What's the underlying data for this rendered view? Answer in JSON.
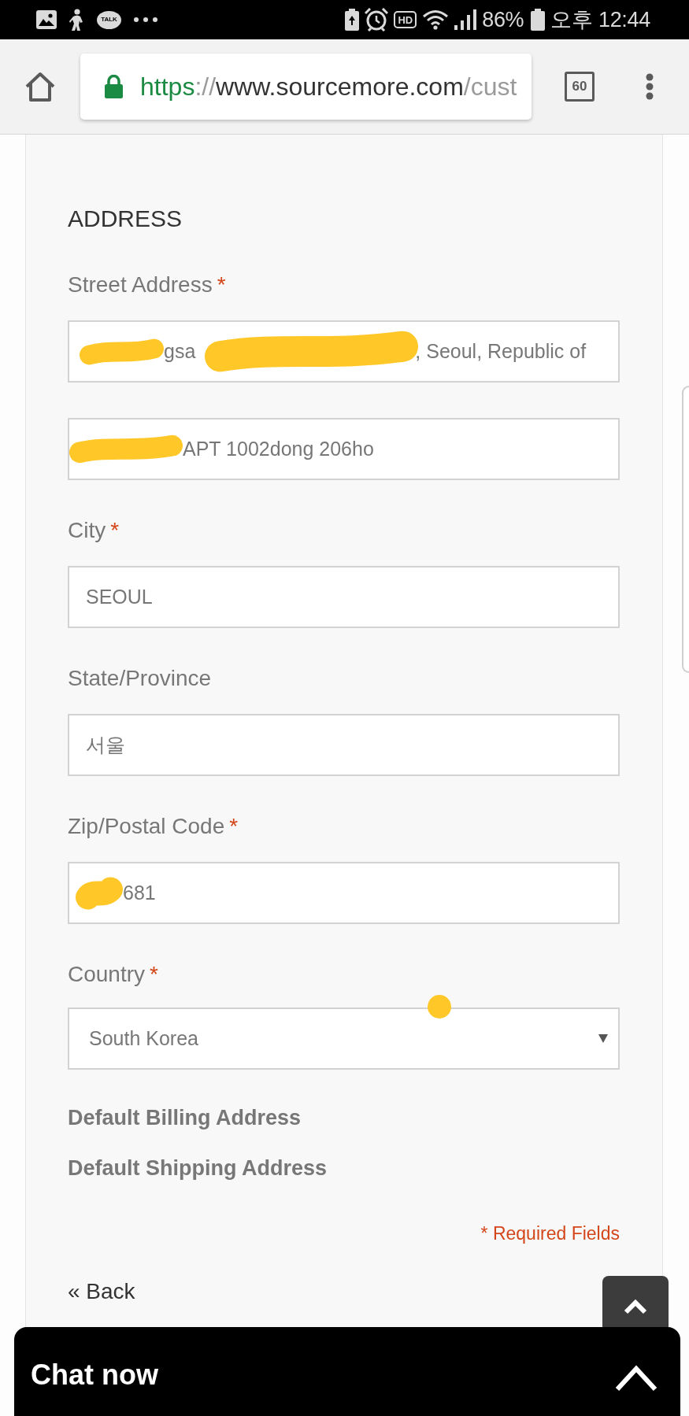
{
  "status_bar": {
    "notification_badge": "TALK",
    "network_badge": "HD",
    "battery": "86%",
    "time": "오후 12:44"
  },
  "browser": {
    "url": {
      "scheme": "https",
      "separator": "://",
      "host": "www.sourcemore.com",
      "path": "/cust"
    },
    "tab_count": "60"
  },
  "form": {
    "heading": "ADDRESS",
    "fields": [
      {
        "kind": "text",
        "label": "Street Address",
        "required_mark": "*",
        "inputs": [
          [
            {
              "kind": "redaction"
            },
            {
              "kind": "text",
              "text": "gsa"
            },
            {
              "kind": "redaction"
            },
            {
              "kind": "text",
              "text": ", Seoul, Republic of"
            }
          ],
          [
            {
              "kind": "redaction"
            },
            {
              "kind": "text",
              "text": "APT 1002dong 206ho"
            }
          ]
        ]
      },
      {
        "kind": "text",
        "label": "City",
        "required_mark": "*",
        "inputs": [
          [
            {
              "kind": "text",
              "text": "SEOUL"
            }
          ]
        ]
      },
      {
        "kind": "text",
        "label": "State/Province",
        "inputs": [
          [
            {
              "kind": "text",
              "text": "서울"
            }
          ]
        ]
      },
      {
        "kind": "text",
        "label": "Zip/Postal Code",
        "required_mark": "*",
        "inputs": [
          [
            {
              "kind": "redaction"
            },
            {
              "kind": "text",
              "text": "681"
            }
          ]
        ]
      },
      {
        "kind": "select",
        "label": "Country",
        "required_mark": "*",
        "value": "South Korea"
      }
    ],
    "default_labels": [
      "Default Billing Address",
      "Default Shipping Address"
    ],
    "required_note": "* Required Fields",
    "back_link": "« Back"
  },
  "chat": {
    "label": "Chat now"
  }
}
